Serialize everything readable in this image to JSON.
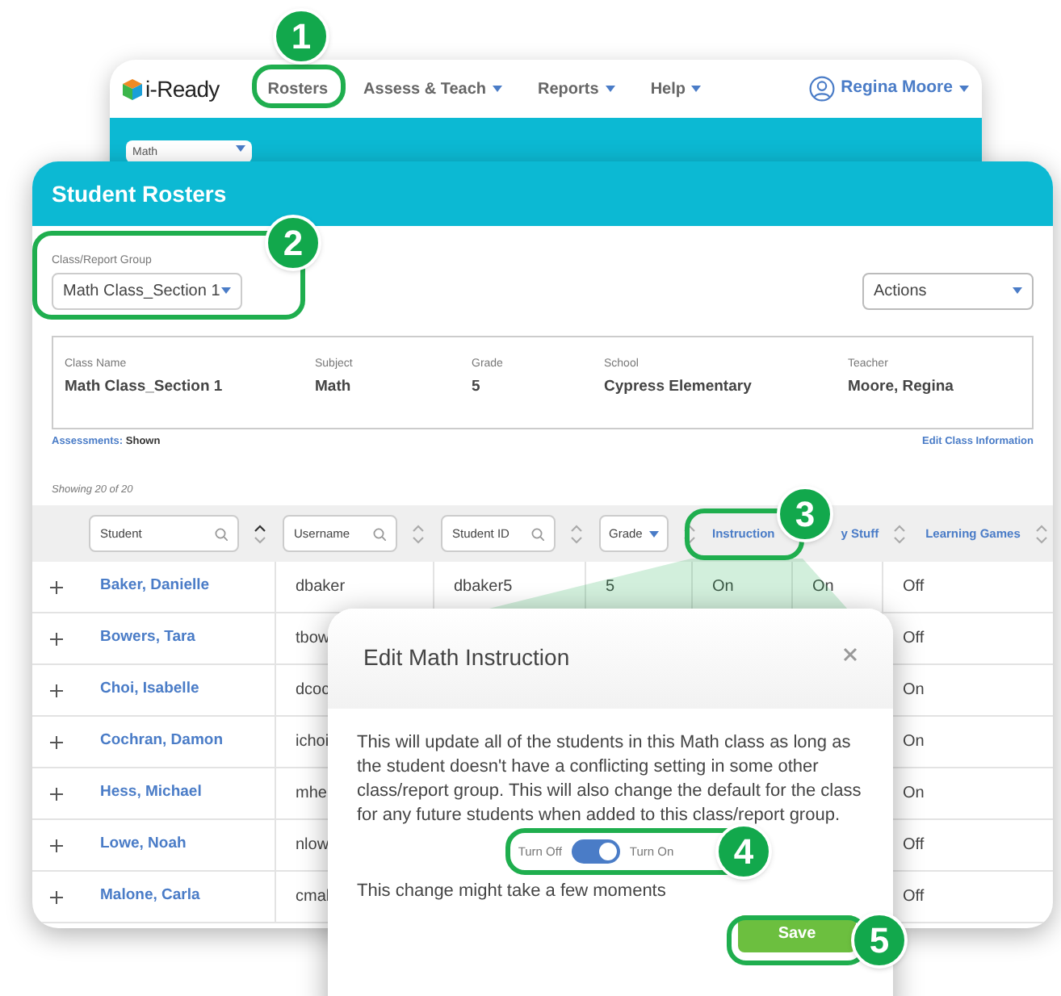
{
  "app_window": {
    "logo": "i-Ready",
    "nav": [
      {
        "label": "Rosters",
        "dropdown": false
      },
      {
        "label": "Assess & Teach",
        "dropdown": true
      },
      {
        "label": "Reports",
        "dropdown": true
      },
      {
        "label": "Help",
        "dropdown": true
      }
    ],
    "user": "Regina Moore",
    "subject_select": "Math"
  },
  "rosters": {
    "title": "Student Rosters",
    "group_label": "Class/Report Group",
    "group_value": "Math Class_Section 1",
    "actions": "Actions",
    "info": [
      {
        "label": "Class Name",
        "value": "Math Class_Section 1"
      },
      {
        "label": "Subject",
        "value": "Math"
      },
      {
        "label": "Grade",
        "value": "5"
      },
      {
        "label": "School",
        "value": "Cypress Elementary"
      },
      {
        "label": "Teacher",
        "value": "Moore, Regina"
      }
    ],
    "assessments_label": "Assessments:",
    "assessments_value": "Shown",
    "edit_link": "Edit Class Information",
    "showing": "Showing 20 of 20",
    "columns": [
      {
        "kind": "search",
        "label": "Student",
        "sorted": true
      },
      {
        "kind": "search",
        "label": "Username",
        "sorted": false
      },
      {
        "kind": "search",
        "label": "Student ID",
        "sorted": false
      },
      {
        "kind": "select",
        "label": "Grade",
        "sorted": false
      },
      {
        "kind": "link",
        "label": "Instruction"
      },
      {
        "kind": "link",
        "label": "y Stuff",
        "sorted": false
      },
      {
        "kind": "link",
        "label": "Learning Games",
        "sorted": false
      }
    ],
    "rows": [
      {
        "cells": [
          "Baker, Danielle",
          "dbaker",
          "dbaker5",
          "5",
          "On",
          "On",
          "Off"
        ]
      },
      {
        "cells": [
          "Bowers, Tara",
          "tbow",
          null,
          null,
          null,
          null,
          "Off"
        ]
      },
      {
        "cells": [
          "Choi, Isabelle",
          "dcoc",
          null,
          null,
          null,
          null,
          "On"
        ]
      },
      {
        "cells": [
          "Cochran, Damon",
          "ichoi",
          null,
          null,
          null,
          null,
          "On"
        ]
      },
      {
        "cells": [
          "Hess, Michael",
          "mhe",
          null,
          null,
          null,
          null,
          "On"
        ]
      },
      {
        "cells": [
          "Lowe, Noah",
          "nlow",
          null,
          null,
          null,
          null,
          "Off"
        ]
      },
      {
        "cells": [
          "Malone, Carla",
          "cmal",
          null,
          null,
          null,
          null,
          "Off"
        ]
      }
    ]
  },
  "dialog": {
    "title": "Edit Math Instruction",
    "message": "This will update all of the students in this Math class as long as the student doesn't have a conflicting setting in some other class/report group. This will also change the default for the class for any future students when added to this class/report group.",
    "off_label": "Turn Off",
    "on_label": "Turn On",
    "on": true,
    "note": "This change might take a few moments",
    "save": "Save"
  },
  "callouts": [
    "1",
    "2",
    "3",
    "4",
    "5"
  ]
}
